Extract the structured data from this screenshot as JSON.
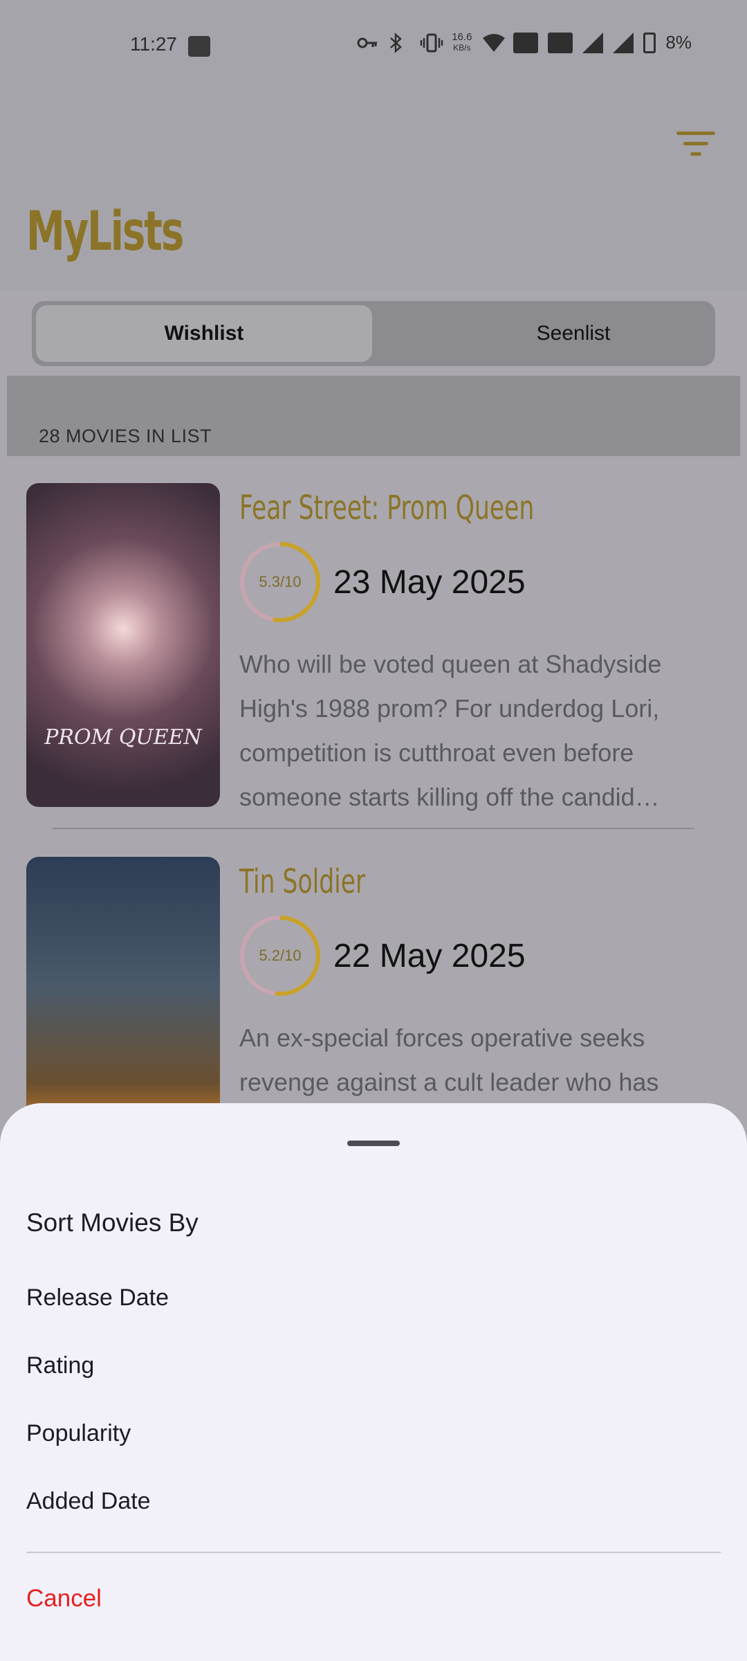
{
  "status_bar": {
    "time": "11:27",
    "net_speed": "16.6",
    "net_unit": "KB/s",
    "battery": "8%"
  },
  "header": {
    "title": "MyLists",
    "filter_icon": "filter-icon",
    "accent_color": "#8b7428"
  },
  "tabs": [
    {
      "label": "Wishlist",
      "active": true
    },
    {
      "label": "Seenlist",
      "active": false
    }
  ],
  "list": {
    "count_label": "28 MOVIES IN LIST",
    "movies": [
      {
        "title": "Fear Street: Prom Queen",
        "rating": "5.3/10",
        "date": "23 May 2025",
        "overview_lines": [
          "Who will be voted queen at Shadyside",
          "High's 1988 prom? For underdog Lori,",
          "competition is cutthroat even before",
          "someone starts killing off the candid…"
        ],
        "poster_text": "PROM QUEEN"
      },
      {
        "title": "Tin Soldier",
        "rating": "5.2/10",
        "date": "22 May 2025",
        "overview_lines": [
          "An ex-special forces operative seeks",
          "revenge against a cult leader who has"
        ]
      }
    ]
  },
  "sort_sheet": {
    "title": "Sort Movies By",
    "options": [
      "Release Date",
      "Rating",
      "Popularity",
      "Added Date"
    ],
    "cancel_label": "Cancel",
    "cancel_color": "#e3211f"
  }
}
